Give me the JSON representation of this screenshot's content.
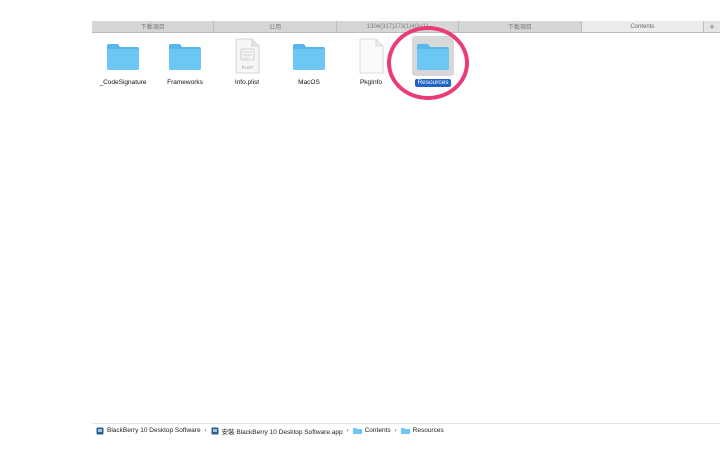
{
  "tabs": [
    {
      "label": "下載項目",
      "active": false
    },
    {
      "label": "公用",
      "active": false
    },
    {
      "label": "1304(317)273(1)40s(1)",
      "active": false
    },
    {
      "label": "下載項目",
      "active": false
    },
    {
      "label": "Contents",
      "active": true
    }
  ],
  "tab_add": "+",
  "items": [
    {
      "label": "_CodeSignature",
      "icon": "folder-icon",
      "selected": false
    },
    {
      "label": "Frameworks",
      "icon": "folder-icon",
      "selected": false
    },
    {
      "label": "Info.plist",
      "icon": "plist-file-icon",
      "badge": "PLIST",
      "selected": false
    },
    {
      "label": "MacOS",
      "icon": "folder-icon",
      "selected": false
    },
    {
      "label": "PkgInfo",
      "icon": "document-icon",
      "selected": false
    },
    {
      "label": "Resources",
      "icon": "folder-icon",
      "selected": true
    }
  ],
  "pathbar": [
    {
      "label": "BlackBerry 10 Desktop Software",
      "icon": "app-icon"
    },
    {
      "label": "安裝 BlackBerry 10 Desktop Software.app",
      "icon": "app-icon"
    },
    {
      "label": "Contents",
      "icon": "folder-icon"
    },
    {
      "label": "Resources",
      "icon": "folder-icon"
    }
  ],
  "separator": "›",
  "colors": {
    "folder": "#6cc7f4",
    "folder_tab": "#58b7ea",
    "selection": "#1f63c6",
    "highlight_ring": "#e93a79",
    "app_icon": "#2c5d8f"
  }
}
